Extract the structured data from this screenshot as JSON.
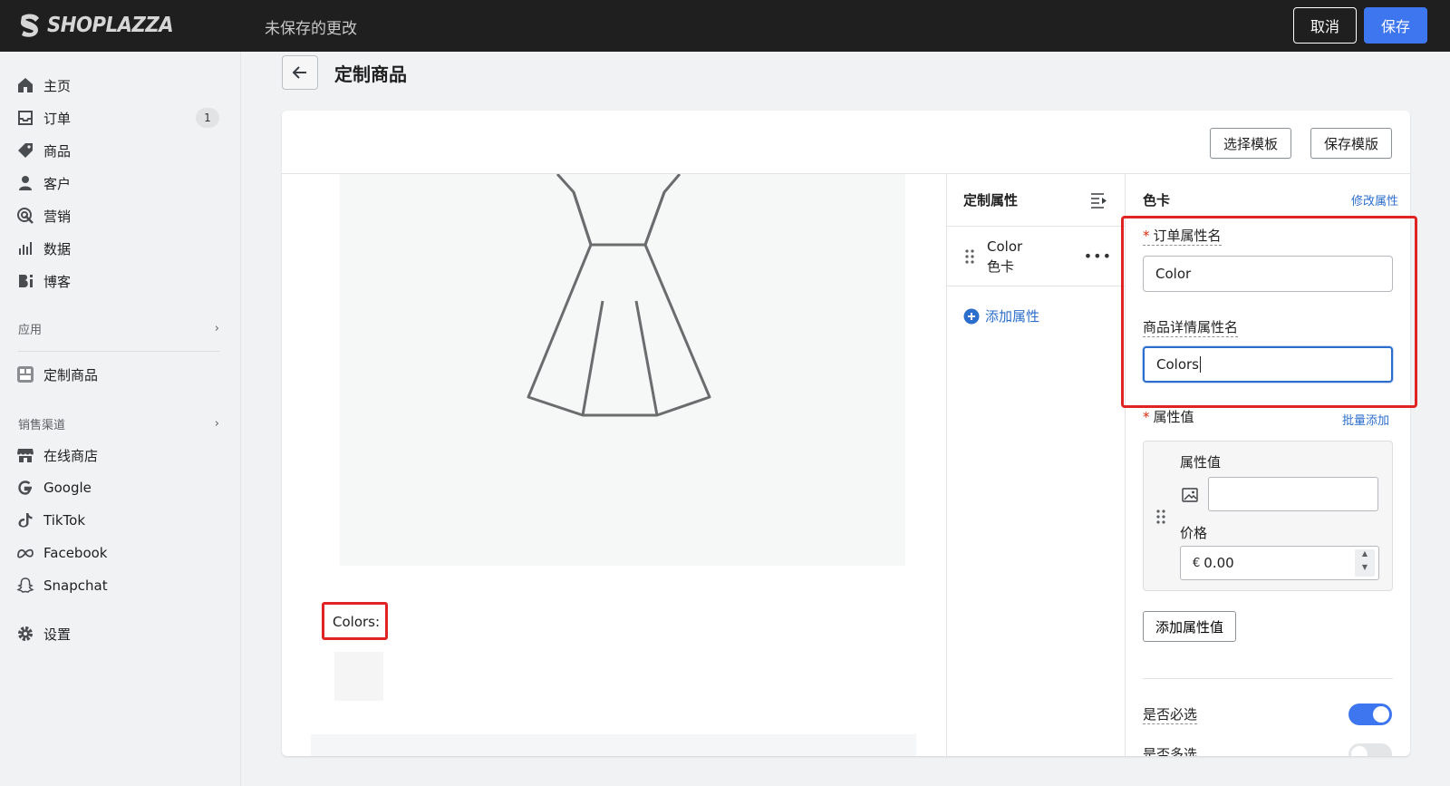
{
  "topbar": {
    "logo_text": "SHOPLAZZA",
    "status": "未保存的更改",
    "cancel_label": "取消",
    "save_label": "保存"
  },
  "sidebar": {
    "items": [
      {
        "label": "主页",
        "icon": "home-icon"
      },
      {
        "label": "订单",
        "icon": "inbox-icon",
        "badge": "1"
      },
      {
        "label": "商品",
        "icon": "tag-icon"
      },
      {
        "label": "客户",
        "icon": "person-icon"
      },
      {
        "label": "营销",
        "icon": "target-icon"
      },
      {
        "label": "数据",
        "icon": "bar-chart-icon"
      },
      {
        "label": "博客",
        "icon": "blog-icon"
      }
    ],
    "apps_section": "应用",
    "app_item": "定制商品",
    "channels_section": "销售渠道",
    "channels": [
      {
        "label": "在线商店",
        "icon": "store-icon"
      },
      {
        "label": "Google",
        "icon": "google-icon"
      },
      {
        "label": "TikTok",
        "icon": "tiktok-icon"
      },
      {
        "label": "Facebook",
        "icon": "meta-icon"
      },
      {
        "label": "Snapchat",
        "icon": "snapchat-icon"
      }
    ],
    "settings": "设置"
  },
  "page": {
    "title": "定制商品",
    "select_template": "选择模板",
    "save_template": "保存模版"
  },
  "preview": {
    "colors_label": "Colors:"
  },
  "attributes": {
    "title": "定制属性",
    "items": [
      {
        "name": "Color",
        "type": "色卡"
      }
    ],
    "add_label": "添加属性"
  },
  "settings": {
    "title": "色卡",
    "edit_link": "修改属性",
    "order_attr_label": "订单属性名",
    "order_attr_value": "Color",
    "detail_attr_label": "商品详情属性名",
    "detail_attr_value": "Colors",
    "values_label": "属性值",
    "bulk_add": "批量添加",
    "value_field_label": "属性值",
    "value_field_value": "",
    "price_label": "价格",
    "price_currency": "€",
    "price_value": "0.00",
    "add_value": "添加属性值",
    "required_label": "是否必选",
    "required_on": true,
    "multi_label": "是否多选",
    "multi_on": false
  },
  "colors": {
    "accent": "#3e76f0",
    "link": "#2c6ecb",
    "highlight": "#e02424"
  }
}
